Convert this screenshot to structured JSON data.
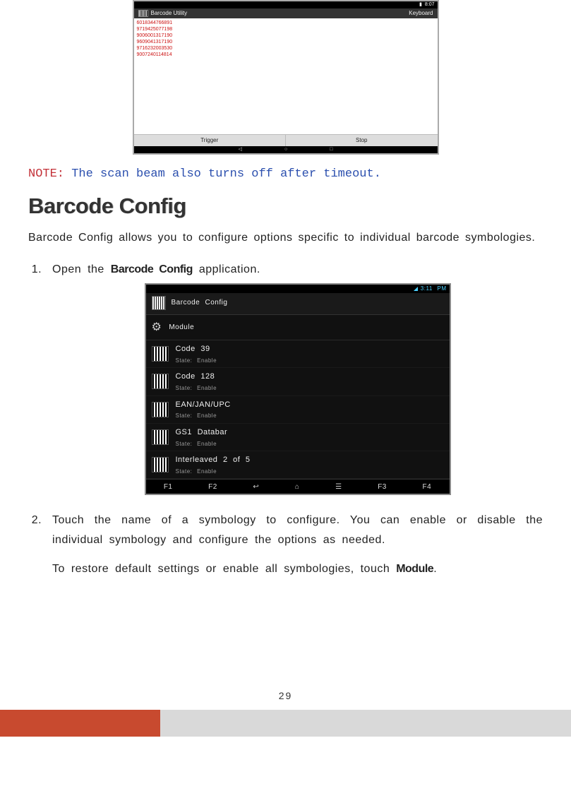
{
  "shot1": {
    "status_time": "8:07",
    "title": "Barcode Utility",
    "keyboard": "Keyboard",
    "codes": [
      "6018344766891",
      "9719425077198",
      "9006001317190",
      "9609041317190",
      "9716232003530",
      "9007240114814"
    ],
    "btn_trigger": "Trigger",
    "btn_stop": "Stop",
    "nav_back": "◁",
    "nav_home": "○",
    "nav_recent": "□"
  },
  "note": {
    "label": "NOTE:",
    "text": "The scan beam also turns off after timeout."
  },
  "heading": "Barcode Config",
  "intro": "Barcode Config allows you to configure options specific to individual barcode symbologies.",
  "step1": {
    "prefix": "Open the ",
    "app": "Barcode Config",
    "suffix": " application."
  },
  "shot2": {
    "status_time": "3:11 PM",
    "title": "Barcode Config",
    "module": "Module",
    "rows": [
      {
        "name": "Code 39",
        "state": "State: Enable"
      },
      {
        "name": "Code 128",
        "state": "State: Enable"
      },
      {
        "name": "EAN/JAN/UPC",
        "state": "State: Enable"
      },
      {
        "name": "GS1 Databar",
        "state": "State: Enable"
      },
      {
        "name": "Interleaved 2 of 5",
        "state": "State: Enable"
      }
    ],
    "keys": {
      "f1": "F1",
      "f2": "F2",
      "back": "↩",
      "home": "⌂",
      "recent": "☰",
      "f3": "F3",
      "f4": "F4"
    }
  },
  "step2": {
    "para1": "Touch the name of a symbology to configure. You can enable or disable the individual symbology and configure the options as needed.",
    "para2_a": "To restore default settings or enable all symbologies, touch ",
    "para2_b": "Module",
    "para2_c": "."
  },
  "page_number": "29"
}
